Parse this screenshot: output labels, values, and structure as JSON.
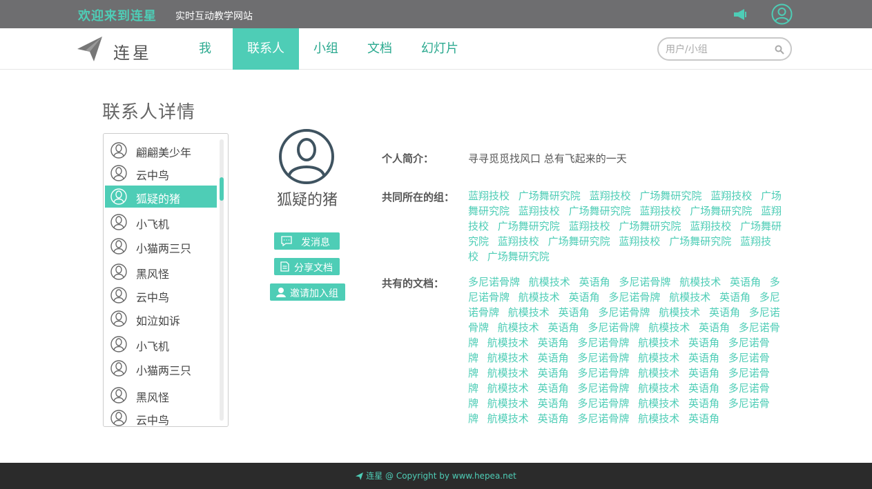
{
  "topbar": {
    "welcome": "欢迎来到连星",
    "slogan": "实时互动教学网站",
    "announce_icon": "megaphone-icon",
    "user_icon": "user-icon"
  },
  "navbar": {
    "brand": "连星",
    "logo_icon": "paper-plane-icon",
    "items": [
      {
        "label": "我"
      },
      {
        "label": "联系人"
      },
      {
        "label": "小组"
      },
      {
        "label": "文档"
      },
      {
        "label": "幻灯片"
      }
    ],
    "active_index": 1,
    "search_placeholder": "用户/小组",
    "search_value": ""
  },
  "page": {
    "title": "联系人详情"
  },
  "contacts": [
    {
      "name": "翩翩美少年"
    },
    {
      "name": "云中鸟"
    },
    {
      "name": "狐疑的猪"
    },
    {
      "name": "小飞机"
    },
    {
      "name": "小猫两三只"
    },
    {
      "name": "黑风怪"
    },
    {
      "name": "云中鸟"
    },
    {
      "name": "如泣如诉"
    },
    {
      "name": "小飞机"
    },
    {
      "name": "小猫两三只"
    },
    {
      "name": "黑风怪"
    },
    {
      "name": "云中鸟"
    }
  ],
  "selected_contact": 2,
  "profile": {
    "name": "狐疑的猪",
    "actions": [
      {
        "label": "发消息",
        "icon": "message-icon"
      },
      {
        "label": "分享文档",
        "icon": "document-icon"
      },
      {
        "label": "邀请加入组",
        "icon": "invite-user-icon"
      }
    ]
  },
  "details": {
    "bio_label": "个人简介：",
    "bio": "寻寻觅觅找风口 总有飞起来的一天",
    "groups_label": "共同所在的组：",
    "groups": [
      "蓝翔技校",
      "广场舞研究院",
      "蓝翔技校",
      "广场舞研究院",
      "蓝翔技校",
      "广场舞研究院",
      "蓝翔技校",
      "广场舞研究院",
      "蓝翔技校",
      "广场舞研究院",
      "蓝翔技校",
      "广场舞研究院",
      "蓝翔技校",
      "广场舞研究院",
      "蓝翔技校",
      "广场舞研究院",
      "蓝翔技校",
      "广场舞研究院",
      "蓝翔技校",
      "广场舞研究院",
      "蓝翔技校",
      "广场舞研究院"
    ],
    "docs_label": "共有的文档：",
    "docs": [
      "多尼诺骨牌",
      "航模技术",
      "英语角",
      "多尼诺骨牌",
      "航模技术",
      "英语角",
      "多尼诺骨牌",
      "航模技术",
      "英语角",
      "多尼诺骨牌",
      "航模技术",
      "英语角",
      "多尼诺骨牌",
      "航模技术",
      "英语角",
      "多尼诺骨牌",
      "航模技术",
      "英语角",
      "多尼诺骨牌",
      "航模技术",
      "英语角",
      "多尼诺骨牌",
      "航模技术",
      "英语角",
      "多尼诺骨牌",
      "航模技术",
      "英语角",
      "多尼诺骨牌",
      "航模技术",
      "英语角",
      "多尼诺骨牌",
      "航模技术",
      "英语角",
      "多尼诺骨牌",
      "航模技术",
      "英语角",
      "多尼诺骨牌",
      "航模技术",
      "英语角",
      "多尼诺骨牌",
      "航模技术",
      "英语角",
      "多尼诺骨牌",
      "航模技术",
      "英语角",
      "多尼诺骨牌",
      "航模技术",
      "英语角",
      "多尼诺骨牌",
      "航模技术",
      "英语角",
      "多尼诺骨牌",
      "航模技术",
      "英语角",
      "多尼诺骨牌",
      "航模技术",
      "英语角",
      "多尼诺骨牌",
      "航模技术",
      "英语角"
    ]
  },
  "footer": {
    "text": "连星 @ Copyright by www.hepea.net"
  },
  "colors": {
    "accent": "#4ecdb6",
    "topbar": "#6e6e70",
    "footer": "#2b2b2b"
  }
}
